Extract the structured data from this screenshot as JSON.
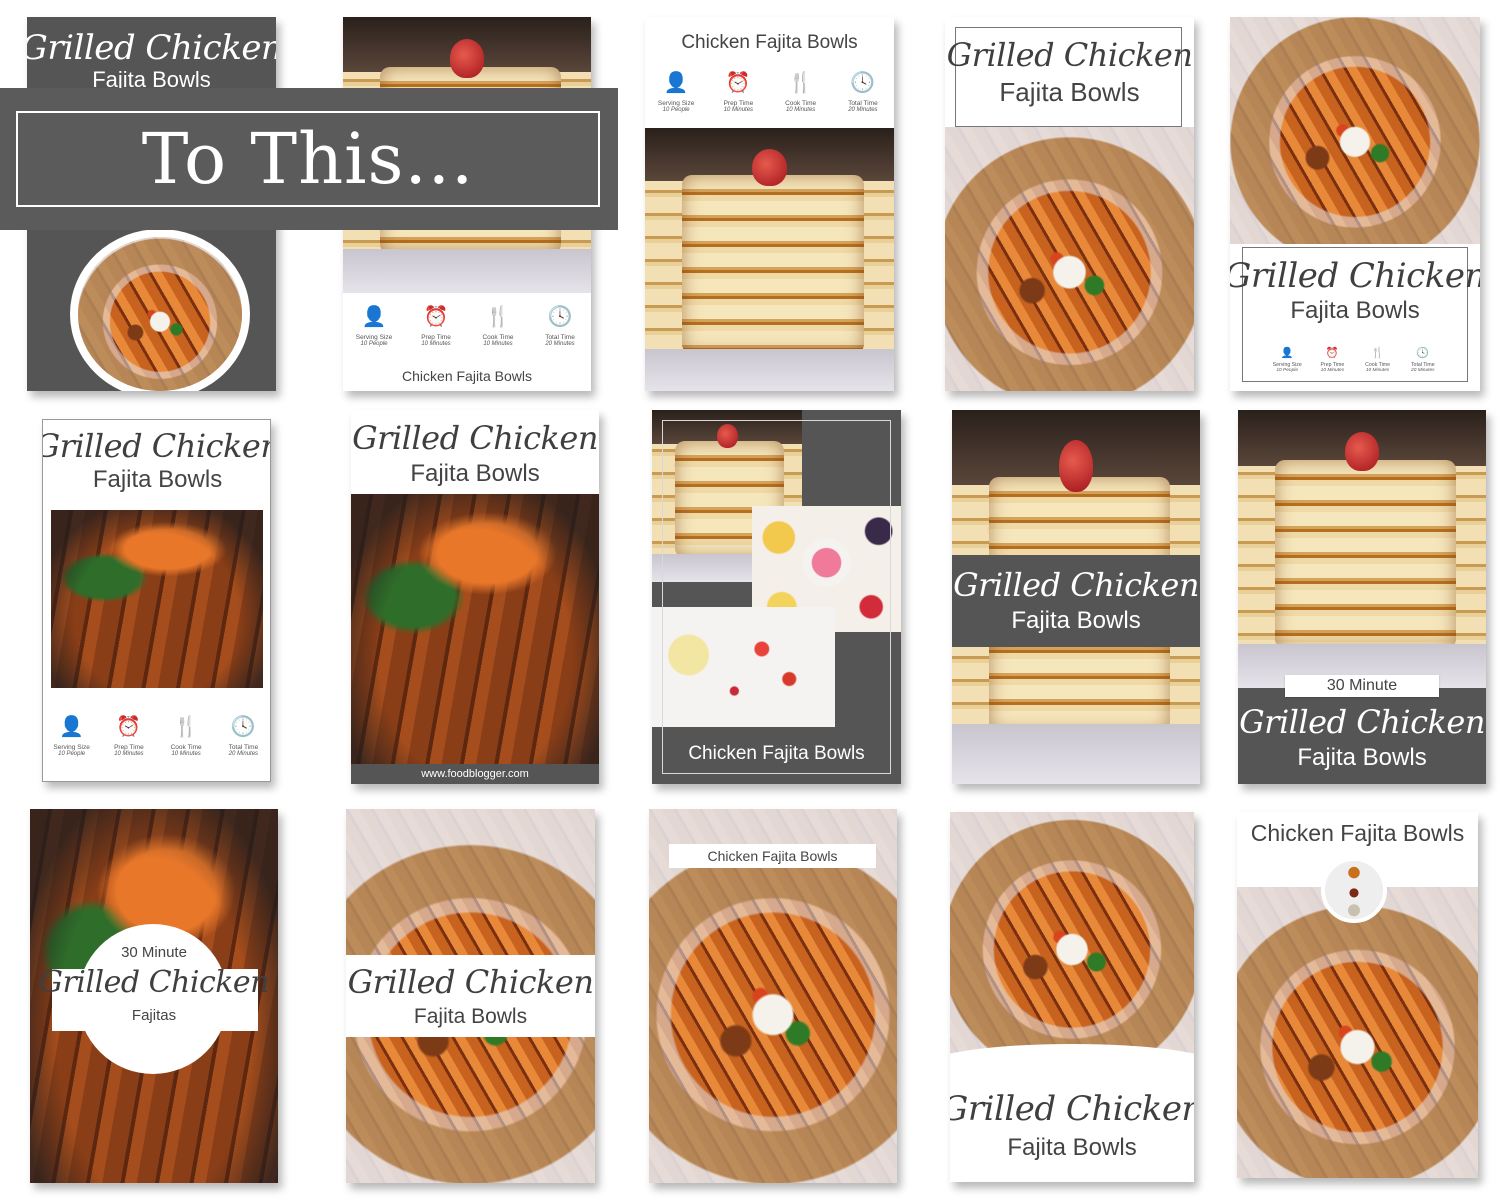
{
  "overlay": {
    "text": "To This..."
  },
  "recipe": {
    "script_title": "Grilled Chicken",
    "subtitle": "Fajita Bowls",
    "short_title": "Chicken Fajita Bowls",
    "minute": "30 Minute",
    "fajitas": "Fajitas",
    "website": "www.foodblogger.com"
  },
  "stats": [
    {
      "icon": "person-icon",
      "glyph": "👤",
      "label": "Serving Size",
      "value": "10 People"
    },
    {
      "icon": "alarm-clock-icon",
      "glyph": "⏰",
      "label": "Prep Time",
      "value": "10 Minutes"
    },
    {
      "icon": "fork-knife-icon",
      "glyph": "🍴",
      "label": "Cook Time",
      "value": "10 Minutes"
    },
    {
      "icon": "clock-icon",
      "glyph": "🕓",
      "label": "Total Time",
      "value": "20 Minutes"
    }
  ],
  "colors": {
    "dark_gray": "#555555",
    "white": "#ffffff",
    "text": "#444444"
  }
}
